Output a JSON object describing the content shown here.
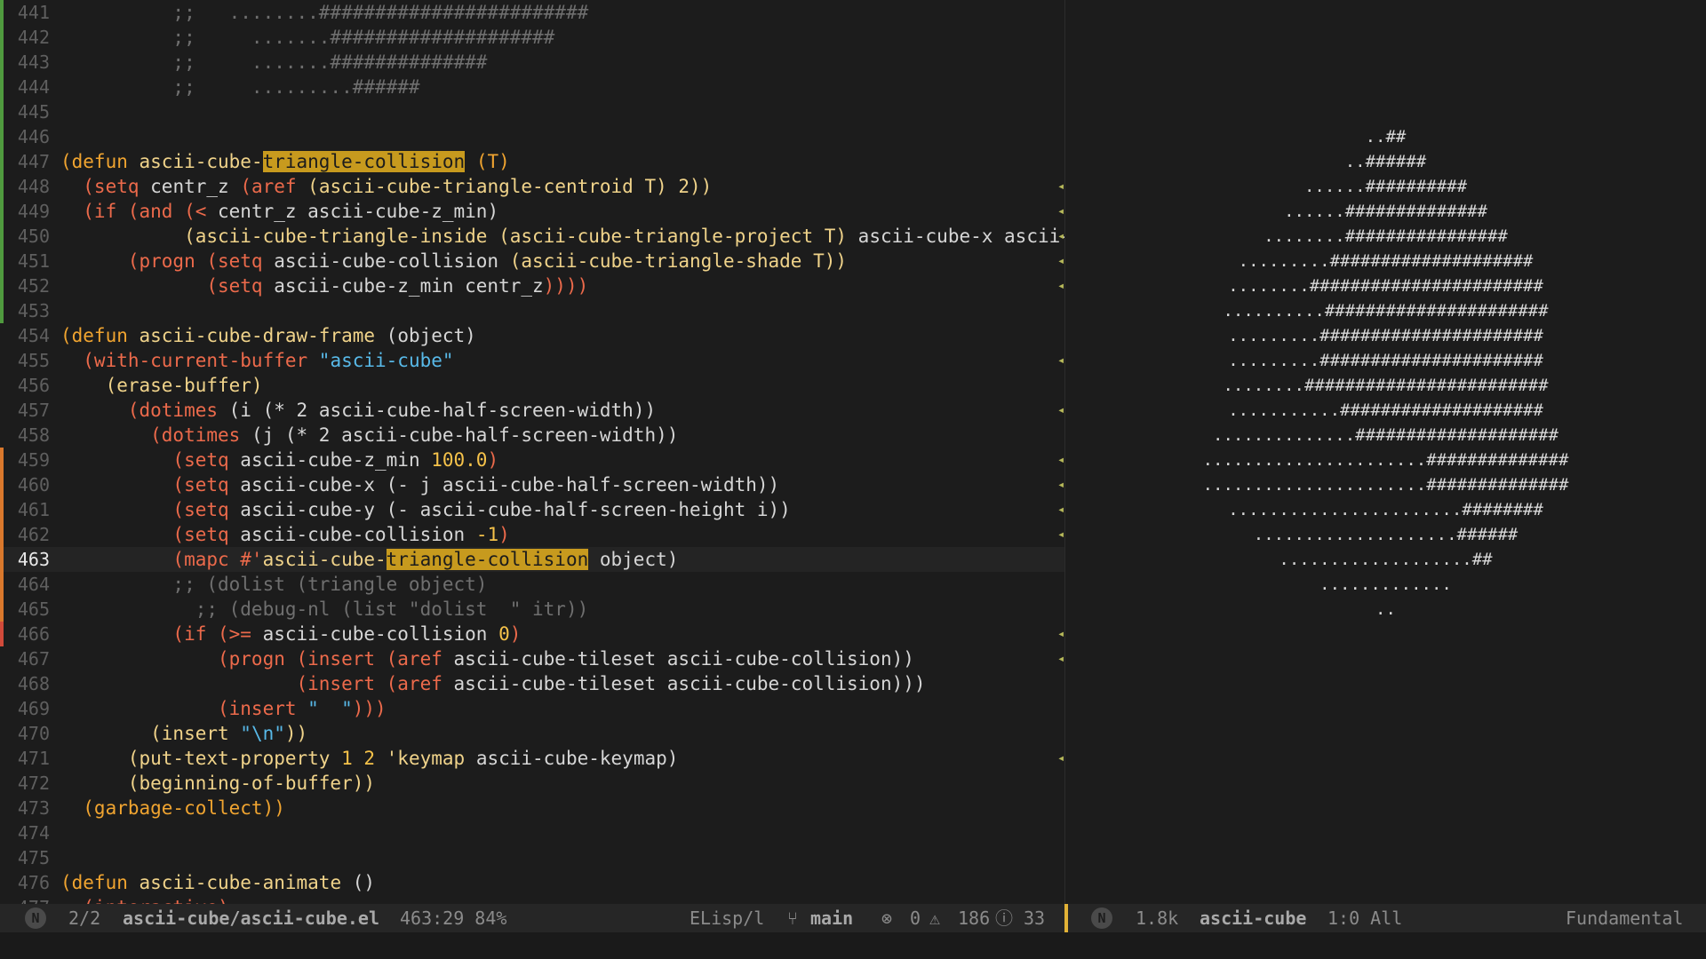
{
  "accent_color": "#e2b236",
  "editor": {
    "lines": [
      {
        "n": "441",
        "git": "green",
        "segs": [
          {
            "t": "          ;;   ........########################",
            "c": "cmt"
          }
        ]
      },
      {
        "n": "442",
        "git": "green",
        "segs": [
          {
            "t": "          ;;     .......####################",
            "c": "cmt"
          }
        ]
      },
      {
        "n": "443",
        "git": "green",
        "segs": [
          {
            "t": "          ;;     .......##############",
            "c": "cmt"
          }
        ]
      },
      {
        "n": "444",
        "git": "green",
        "segs": [
          {
            "t": "          ;;     .........######",
            "c": "cmt"
          }
        ]
      },
      {
        "n": "445",
        "git": "green",
        "segs": []
      },
      {
        "n": "446",
        "git": "green",
        "segs": []
      },
      {
        "n": "447",
        "git": "green",
        "segs": [
          {
            "t": "(defun ",
            "c": "def"
          },
          {
            "t": "ascii-cube-",
            "c": "fn"
          },
          {
            "t": "triangle-collision",
            "c": "hl"
          },
          {
            "t": " (T)",
            "c": "def"
          }
        ]
      },
      {
        "n": "448",
        "git": "green",
        "fringe": "◂",
        "segs": [
          {
            "t": "  (setq ",
            "c": "kw"
          },
          {
            "t": "centr_z ",
            "c": "plain"
          },
          {
            "t": "(aref ",
            "c": "kw"
          },
          {
            "t": "(ascii-cube-triangle-centroid T) 2))",
            "c": "fn"
          }
        ]
      },
      {
        "n": "449",
        "git": "green",
        "fringe": "◂",
        "segs": [
          {
            "t": "  (if (and (< ",
            "c": "kw"
          },
          {
            "t": "centr_z ascii-cube-z_min)",
            "c": "plain"
          }
        ]
      },
      {
        "n": "450",
        "git": "green",
        "fringe": "◂",
        "segs": [
          {
            "t": "           (ascii-cube-triangle-inside (ascii-cube-triangle-project T) ",
            "c": "fn"
          },
          {
            "t": "ascii-cube-x ascii-cube",
            "c": "plain"
          }
        ]
      },
      {
        "n": "451",
        "git": "green",
        "fringe": "◂",
        "segs": [
          {
            "t": "      (progn (setq ",
            "c": "kw"
          },
          {
            "t": "ascii-cube-collision ",
            "c": "plain"
          },
          {
            "t": "(ascii-cube-triangle-shade T))",
            "c": "fn"
          }
        ]
      },
      {
        "n": "452",
        "git": "green",
        "fringe": "◂",
        "segs": [
          {
            "t": "             (setq ",
            "c": "kw"
          },
          {
            "t": "ascii-cube-z_min centr_z",
            "c": "plain"
          },
          {
            "t": "))))",
            "c": "kw"
          }
        ]
      },
      {
        "n": "453",
        "git": "green",
        "segs": []
      },
      {
        "n": "454",
        "segs": [
          {
            "t": "(defun ",
            "c": "def"
          },
          {
            "t": "ascii-cube-draw-frame ",
            "c": "fn"
          },
          {
            "t": "(object)",
            "c": "plain"
          }
        ]
      },
      {
        "n": "455",
        "fringe": "◂",
        "segs": [
          {
            "t": "  (with-current-buffer ",
            "c": "kw"
          },
          {
            "t": "\"ascii-cube\"",
            "c": "str"
          }
        ]
      },
      {
        "n": "456",
        "segs": [
          {
            "t": "    (erase-buffer)",
            "c": "fn"
          }
        ]
      },
      {
        "n": "457",
        "fringe": "◂",
        "segs": [
          {
            "t": "      (dotimes ",
            "c": "kw"
          },
          {
            "t": "(i (* 2 ",
            "c": "plain"
          },
          {
            "t": "ascii-cube-half-screen-width))",
            "c": "plain"
          }
        ]
      },
      {
        "n": "458",
        "segs": [
          {
            "t": "        (dotimes ",
            "c": "kw"
          },
          {
            "t": "(j (* 2 ascii-cube-half-screen-width))",
            "c": "plain"
          }
        ]
      },
      {
        "n": "459",
        "git": "orange",
        "fringe": "◂",
        "segs": [
          {
            "t": "          (setq ",
            "c": "kw"
          },
          {
            "t": "ascii-cube-z_min ",
            "c": "plain"
          },
          {
            "t": "100.0",
            "c": "num"
          },
          {
            "t": ")",
            "c": "kw"
          }
        ]
      },
      {
        "n": "460",
        "git": "orange",
        "fringe": "◂",
        "segs": [
          {
            "t": "          (setq ",
            "c": "kw"
          },
          {
            "t": "ascii-cube-x (- j ascii-cube-half-screen-width))",
            "c": "plain"
          }
        ]
      },
      {
        "n": "461",
        "git": "orange",
        "fringe": "◂",
        "segs": [
          {
            "t": "          (setq ",
            "c": "kw"
          },
          {
            "t": "ascii-cube-y (- ascii-cube-half-screen-height i))",
            "c": "plain"
          }
        ]
      },
      {
        "n": "462",
        "git": "orange",
        "fringe": "◂",
        "segs": [
          {
            "t": "          (setq ",
            "c": "kw"
          },
          {
            "t": "ascii-cube-collision ",
            "c": "plain"
          },
          {
            "t": "-1",
            "c": "num"
          },
          {
            "t": ")",
            "c": "kw"
          }
        ]
      },
      {
        "n": "463",
        "git": "orange",
        "current": true,
        "segs": [
          {
            "t": "          (mapc #'",
            "c": "kw"
          },
          {
            "t": "ascii-cube-",
            "c": "fn"
          },
          {
            "t": "triangle-collision",
            "c": "hl"
          },
          {
            "t": " object)",
            "c": "plain"
          }
        ]
      },
      {
        "n": "464",
        "git": "orange",
        "segs": [
          {
            "t": "          ;; (dolist (triangle object)",
            "c": "cmt"
          }
        ]
      },
      {
        "n": "465",
        "git": "orange",
        "segs": [
          {
            "t": "            ;; (debug-nl (list \"dolist  \" itr))",
            "c": "cmt"
          }
        ]
      },
      {
        "n": "466",
        "git": "red",
        "fringe": "◂",
        "segs": [
          {
            "t": "          (if (>= ",
            "c": "kw"
          },
          {
            "t": "ascii-cube-collision ",
            "c": "plain"
          },
          {
            "t": "0",
            "c": "num"
          },
          {
            "t": ")",
            "c": "kw"
          }
        ]
      },
      {
        "n": "467",
        "fringe": "◂",
        "segs": [
          {
            "t": "              (progn (insert (aref ",
            "c": "kw"
          },
          {
            "t": "ascii-cube-tileset ascii-cube-collision))",
            "c": "plain"
          }
        ]
      },
      {
        "n": "468",
        "segs": [
          {
            "t": "                     (insert (aref ",
            "c": "kw"
          },
          {
            "t": "ascii-cube-tileset ascii-cube-collision)))",
            "c": "plain"
          }
        ]
      },
      {
        "n": "469",
        "segs": [
          {
            "t": "              (insert ",
            "c": "kw"
          },
          {
            "t": "\"  \"",
            "c": "str"
          },
          {
            "t": ")))",
            "c": "kw"
          }
        ]
      },
      {
        "n": "470",
        "segs": [
          {
            "t": "        (insert ",
            "c": "fn"
          },
          {
            "t": "\"\\n\"",
            "c": "str"
          },
          {
            "t": "))",
            "c": "fn"
          }
        ]
      },
      {
        "n": "471",
        "fringe": "◂",
        "segs": [
          {
            "t": "      (put-text-property ",
            "c": "fn"
          },
          {
            "t": "1 2 ",
            "c": "num"
          },
          {
            "t": "'keymap ",
            "c": "fn"
          },
          {
            "t": "ascii-cube-keymap)",
            "c": "plain"
          }
        ]
      },
      {
        "n": "472",
        "segs": [
          {
            "t": "      (beginning-of-buffer))",
            "c": "fn"
          }
        ]
      },
      {
        "n": "473",
        "segs": [
          {
            "t": "  (garbage-collect))",
            "c": "def"
          }
        ]
      },
      {
        "n": "474",
        "segs": []
      },
      {
        "n": "475",
        "segs": []
      },
      {
        "n": "476",
        "segs": [
          {
            "t": "(defun ",
            "c": "def"
          },
          {
            "t": "ascii-cube-animate ",
            "c": "fn"
          },
          {
            "t": "()",
            "c": "plain"
          }
        ]
      },
      {
        "n": "477",
        "segs": [
          {
            "t": "  (interactive)",
            "c": "kw"
          }
        ]
      }
    ]
  },
  "ascii_view": {
    "lines": [
      "",
      "",
      "",
      "",
      "",
      "..##",
      "..######",
      "......##########",
      "......##############",
      "........################",
      ".........####################",
      "........#######################",
      "..........######################",
      ".........######################",
      ".........######################",
      "........########################",
      "...........####################",
      "..............####################",
      "......................##############",
      "......................##############",
      ".......................########",
      "....................######",
      "...................##",
      ".............",
      ".."
    ]
  },
  "mode_line": {
    "left": {
      "state_badge": "N",
      "buffer_index": "2/2",
      "file_path": "ascii-cube/ascii-cube.el",
      "position": "463:29 84%",
      "major_mode": "ELisp/l",
      "branch_icon": "branch-icon",
      "branch": "main",
      "errors": "0",
      "warnings": "186",
      "infos": "33"
    },
    "right": {
      "state_badge": "N",
      "size": "1.8k",
      "buffer_name": "ascii-cube",
      "position": "1:0 All",
      "major_mode": "Fundamental"
    }
  }
}
